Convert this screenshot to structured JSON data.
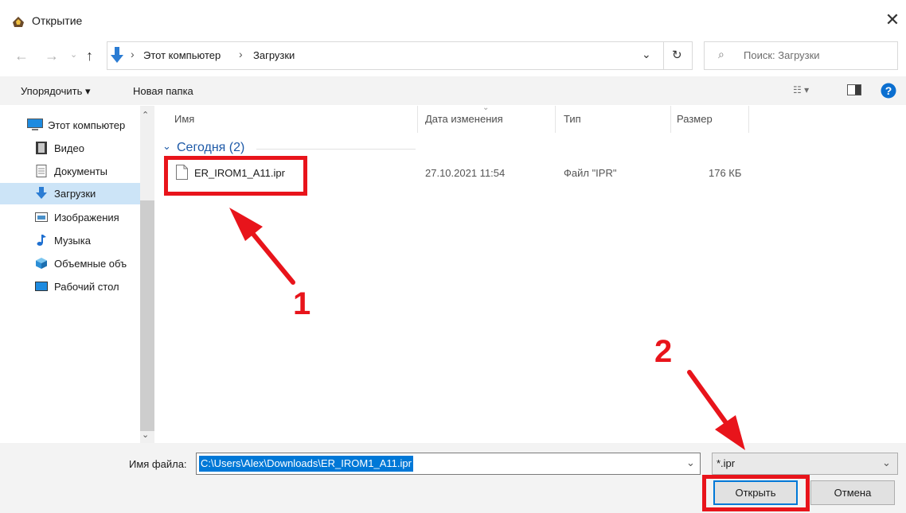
{
  "window": {
    "title": "Открытие"
  },
  "address": {
    "crumbs": [
      "Этот компьютер",
      "Загрузки"
    ]
  },
  "search": {
    "placeholder": "Поиск: Загрузки"
  },
  "toolbar": {
    "organize": "Упорядочить ▾",
    "new_folder": "Новая папка"
  },
  "sidebar": {
    "items": [
      {
        "label": "Этот компьютер",
        "icon": "computer-icon"
      },
      {
        "label": "Видео",
        "icon": "video-icon"
      },
      {
        "label": "Документы",
        "icon": "documents-icon"
      },
      {
        "label": "Загрузки",
        "icon": "downloads-icon",
        "selected": true
      },
      {
        "label": "Изображения",
        "icon": "pictures-icon"
      },
      {
        "label": "Музыка",
        "icon": "music-icon"
      },
      {
        "label": "Объемные объ",
        "icon": "3d-objects-icon"
      },
      {
        "label": "Рабочий стол",
        "icon": "desktop-icon"
      }
    ]
  },
  "columns": {
    "name": "Имя",
    "date": "Дата изменения",
    "type": "Тип",
    "size": "Размер"
  },
  "group": {
    "label": "Сегодня (2)"
  },
  "files": [
    {
      "name": "ER_IROM1_A11.ipr",
      "date": "27.10.2021 11:54",
      "type": "Файл \"IPR\"",
      "size": "176 КБ"
    }
  ],
  "footer": {
    "filename_label": "Имя файла:",
    "filename_value": "C:\\Users\\Alex\\Downloads\\ER_IROM1_A11.ipr",
    "filetype_value": "*.ipr",
    "open_label": "Открыть",
    "cancel_label": "Отмена"
  },
  "annotations": {
    "step1": "1",
    "step2": "2"
  },
  "colors": {
    "accent": "#0078d7",
    "annotation_red": "#e8141b",
    "selection": "#cce4f7"
  }
}
